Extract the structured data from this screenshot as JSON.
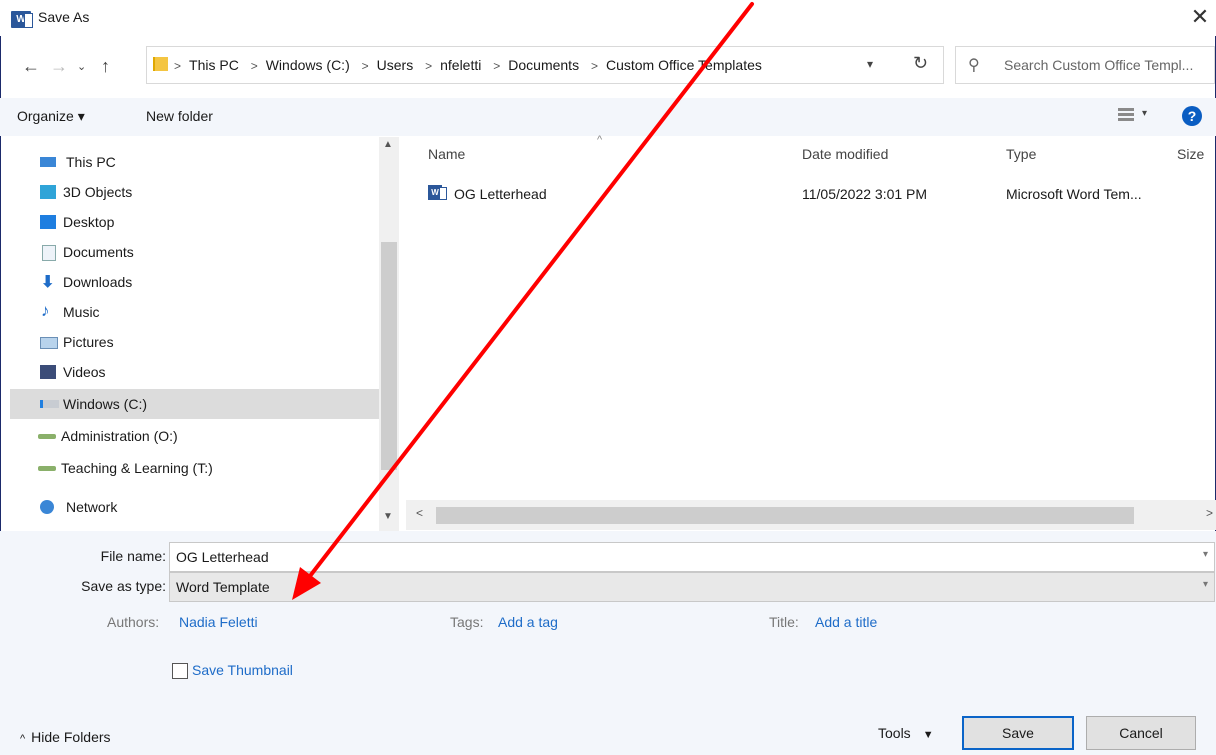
{
  "window": {
    "title": "Save As"
  },
  "address": {
    "crumbs": [
      "This PC",
      "Windows (C:)",
      "Users",
      "nfeletti",
      "Documents",
      "Custom Office Templates"
    ],
    "search_placeholder": "Search Custom Office Templ..."
  },
  "toolbar": {
    "organize": "Organize ▾",
    "new_folder": "New folder"
  },
  "sidebar": {
    "items": [
      {
        "label": "This PC",
        "icon": "pc-icon"
      },
      {
        "label": "3D Objects",
        "icon": "3d-objects-icon"
      },
      {
        "label": "Desktop",
        "icon": "desktop-icon"
      },
      {
        "label": "Documents",
        "icon": "documents-icon"
      },
      {
        "label": "Downloads",
        "icon": "downloads-icon"
      },
      {
        "label": "Music",
        "icon": "music-icon"
      },
      {
        "label": "Pictures",
        "icon": "pictures-icon"
      },
      {
        "label": "Videos",
        "icon": "videos-icon"
      },
      {
        "label": "Windows (C:)",
        "icon": "drive-icon",
        "selected": true
      },
      {
        "label": "Administration (O:)",
        "icon": "network-drive-icon"
      },
      {
        "label": "Teaching & Learning (T:)",
        "icon": "network-drive-icon"
      },
      {
        "label": "Network",
        "icon": "network-icon"
      }
    ]
  },
  "file_list": {
    "columns": [
      "Name",
      "Date modified",
      "Type",
      "Size"
    ],
    "rows": [
      {
        "name": "OG Letterhead",
        "date": "11/05/2022 3:01 PM",
        "type": "Microsoft Word Tem..."
      }
    ]
  },
  "form": {
    "file_name_label": "File name:",
    "file_name_value": "OG Letterhead",
    "save_type_label": "Save as type:",
    "save_type_value": "Word Template",
    "authors_label": "Authors:",
    "authors_value": "Nadia Feletti",
    "tags_label": "Tags:",
    "tags_value": "Add a tag",
    "title_label": "Title:",
    "title_value": "Add a title",
    "thumbnail_label": "Save Thumbnail"
  },
  "footer": {
    "hide_folders": "Hide Folders",
    "tools": "Tools",
    "save": "Save",
    "cancel": "Cancel"
  },
  "colors": {
    "accent": "#0a64c8",
    "link": "#1e6cc8",
    "arrow": "#ff0000",
    "word_blue": "#2b579a"
  }
}
